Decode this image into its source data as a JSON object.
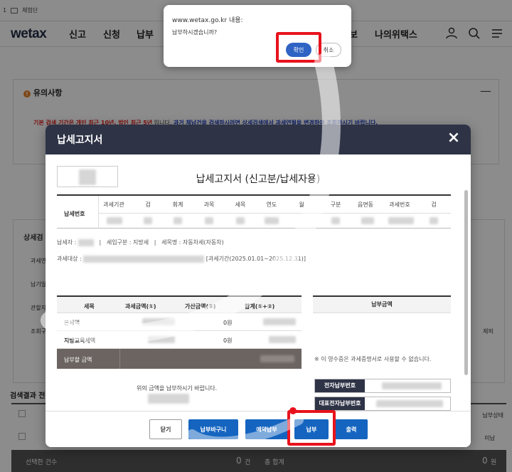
{
  "browser_tab": {
    "line_number": "1",
    "folder_label": "체험단"
  },
  "header": {
    "logo": "wetax",
    "nav": [
      "신고",
      "신청",
      "납부",
      "나의위택스"
    ],
    "nav_partial": "보"
  },
  "notice": {
    "title": "유의사항",
    "line1_red": "기본 검색 기간은 개인 최근 10년, 법인 최근 5년",
    "line1_mid": " 입니다. ",
    "line1_blue": "과거 체납건을 검색하시려면 상세검색에서 과세연월을 변경하여 조회하시기 바랍니다."
  },
  "detail": {
    "title": "상세검",
    "rows": [
      "과세연",
      "납기일",
      "관할지",
      "조회구"
    ],
    "right_partial": "제외"
  },
  "result": {
    "title": "검색결과 전",
    "status_header": "납부상태",
    "status_value": "미납",
    "selected_count_label": "선택한 건수",
    "selected_count_value": "0",
    "count_unit": "건",
    "total_label": "총 합계",
    "total_value": "0",
    "won_unit": "원"
  },
  "modal": {
    "title": "납세고지서",
    "doc_title": "납세고지서 (신고분/납세자용)",
    "tax_number_label": "납세번호",
    "tax_columns": [
      "과세기관",
      "검",
      "회계",
      "과목",
      "세목",
      "연도",
      "월",
      "구분",
      "읍면동",
      "과세번호",
      "검"
    ],
    "taxpayer_label": "납세자 :",
    "tax_type_label": "세입구분 : 지방세",
    "tax_item_label": "세목명 : 자동차세(자동차)",
    "target_label": "과세대상 :",
    "period": "[과세기간(2025.01.01~2025.12.31)]",
    "amount_headers": [
      "세목",
      "과세금액(①)",
      "가산금액(②)",
      "합계(①+②)"
    ],
    "amount_rows": [
      {
        "name": "본세액",
        "surcharge": "0원"
      },
      {
        "name": "지방교육세액",
        "surcharge": "0원"
      }
    ],
    "total_label": "납부할 금액",
    "pay_header": "납부금액",
    "receipt_note": "※ 이 영수증은 과세증명서로 사용할 수 없습니다.",
    "pay_message": "위의 금액을 납부하시기 바랍니다.",
    "e_pay_label": "전자납부번호",
    "rep_pay_label": "대표전자납부번호",
    "buttons": {
      "close": "닫기",
      "cart": "납부바구니",
      "reserve": "예약납부",
      "pay": "납부",
      "print": "출력"
    }
  },
  "alert": {
    "origin": "www.wetax.go.kr 내용:",
    "message": "납부하시겠습니까?",
    "ok": "확인",
    "cancel": "취소"
  },
  "colors": {
    "highlight": "#e8121c",
    "modal_header": "#2e3346",
    "primary_button": "#1565c0",
    "alert_ok": "#2f63c4"
  }
}
